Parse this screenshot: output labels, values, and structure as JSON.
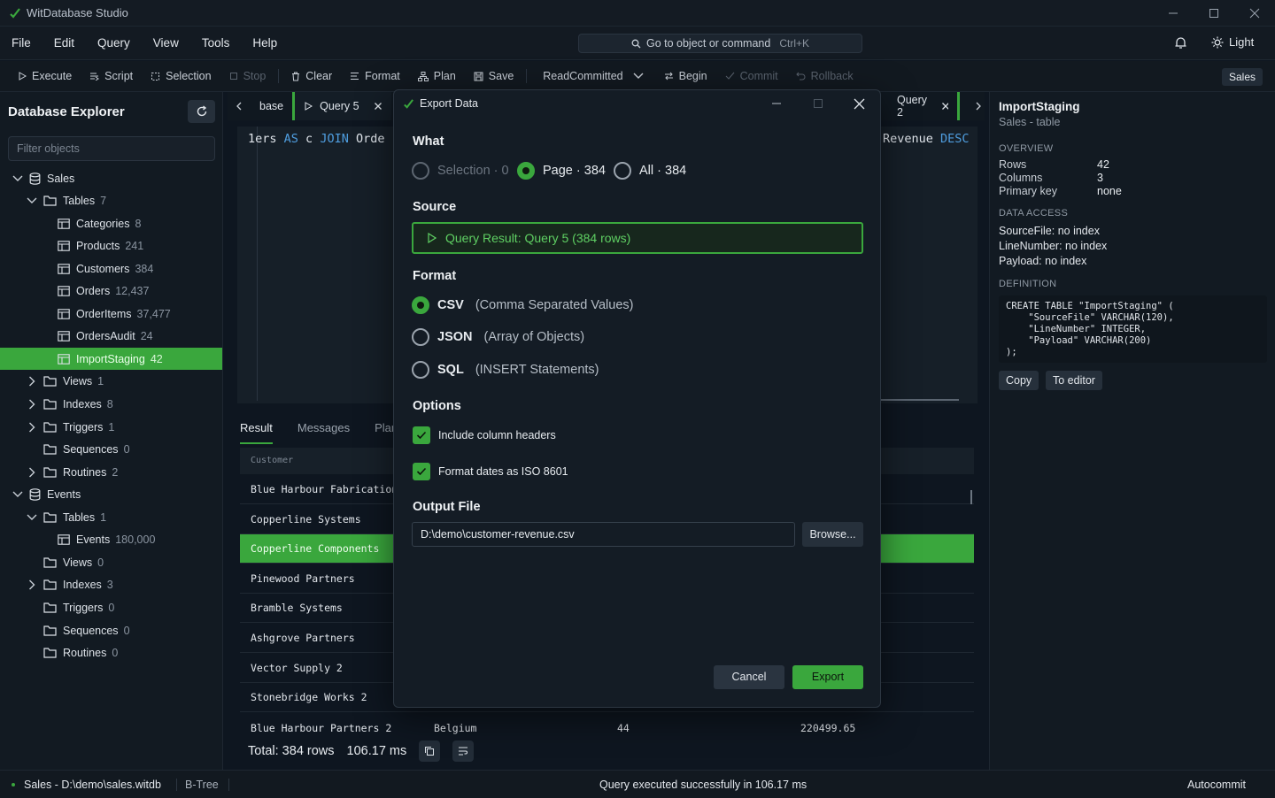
{
  "app": {
    "title": "WitDatabase Studio"
  },
  "menu": [
    "File",
    "Edit",
    "Query",
    "View",
    "Tools",
    "Help"
  ],
  "command": {
    "placeholder": "Go to object or command",
    "shortcut": "Ctrl+K"
  },
  "theme_label": "Light",
  "toolbar": {
    "execute": "Execute",
    "script": "Script",
    "selection": "Selection",
    "stop": "Stop",
    "clear": "Clear",
    "format": "Format",
    "plan": "Plan",
    "save": "Save",
    "isolation": "ReadCommitted",
    "begin": "Begin",
    "commit": "Commit",
    "rollback": "Rollback",
    "db": "Sales"
  },
  "explorer": {
    "title": "Database Explorer",
    "filter_placeholder": "Filter objects",
    "tree": [
      {
        "label": "Sales",
        "count": "",
        "level": 0,
        "kind": "db",
        "chev": "down"
      },
      {
        "label": "Tables",
        "count": "7",
        "level": 1,
        "kind": "folder",
        "chev": "down"
      },
      {
        "label": "Categories",
        "count": "8",
        "level": 2,
        "kind": "table",
        "chev": ""
      },
      {
        "label": "Products",
        "count": "241",
        "level": 2,
        "kind": "table",
        "chev": ""
      },
      {
        "label": "Customers",
        "count": "384",
        "level": 2,
        "kind": "table",
        "chev": ""
      },
      {
        "label": "Orders",
        "count": "12,437",
        "level": 2,
        "kind": "table",
        "chev": ""
      },
      {
        "label": "OrderItems",
        "count": "37,477",
        "level": 2,
        "kind": "table",
        "chev": ""
      },
      {
        "label": "OrdersAudit",
        "count": "24",
        "level": 2,
        "kind": "table",
        "chev": ""
      },
      {
        "label": "ImportStaging",
        "count": "42",
        "level": 2,
        "kind": "table",
        "chev": "",
        "selected": true
      },
      {
        "label": "Views",
        "count": "1",
        "level": 1,
        "kind": "folder",
        "chev": "right"
      },
      {
        "label": "Indexes",
        "count": "8",
        "level": 1,
        "kind": "folder",
        "chev": "right"
      },
      {
        "label": "Triggers",
        "count": "1",
        "level": 1,
        "kind": "folder",
        "chev": "right"
      },
      {
        "label": "Sequences",
        "count": "0",
        "level": 1,
        "kind": "folder",
        "chev": ""
      },
      {
        "label": "Routines",
        "count": "2",
        "level": 1,
        "kind": "folder",
        "chev": "right"
      },
      {
        "label": "Events",
        "count": "",
        "level": 0,
        "kind": "db",
        "chev": "down"
      },
      {
        "label": "Tables",
        "count": "1",
        "level": 1,
        "kind": "folder",
        "chev": "down"
      },
      {
        "label": "Events",
        "count": "180,000",
        "level": 2,
        "kind": "table",
        "chev": ""
      },
      {
        "label": "Views",
        "count": "0",
        "level": 1,
        "kind": "folder",
        "chev": ""
      },
      {
        "label": "Indexes",
        "count": "3",
        "level": 1,
        "kind": "folder",
        "chev": "right"
      },
      {
        "label": "Triggers",
        "count": "0",
        "level": 1,
        "kind": "folder",
        "chev": ""
      },
      {
        "label": "Sequences",
        "count": "0",
        "level": 1,
        "kind": "folder",
        "chev": ""
      },
      {
        "label": "Routines",
        "count": "0",
        "level": 1,
        "kind": "folder",
        "chev": ""
      }
    ]
  },
  "tabs": {
    "left_partial": "base",
    "query5": "Query 5",
    "query2": "Query 2"
  },
  "editor": {
    "line_no": "1",
    "left": {
      "a": "ers ",
      "k1": "AS",
      "b": " c ",
      "k2": "JOIN",
      "c": " Orde"
    },
    "right": {
      "a": "Revenue ",
      "k": "DESC"
    }
  },
  "result": {
    "tabs": [
      "Result",
      "Messages",
      "Plan"
    ],
    "column_header": "Customer",
    "rows": [
      "Blue Harbour Fabrication",
      "Copperline Systems",
      "Copperline Components",
      "Pinewood Partners",
      "Bramble Systems",
      "Ashgrove Partners",
      "Vector Supply 2",
      "Stonebridge Works 2"
    ],
    "last_row": {
      "customer": "Blue Harbour Partners 2",
      "country": "Belgium",
      "orders": "44",
      "revenue": "220499.65"
    },
    "selected_row": 2,
    "total": "Total: 384 rows",
    "time": "106.17 ms"
  },
  "panel": {
    "name": "ImportStaging",
    "subtitle": "Sales - table",
    "overview_label": "OVERVIEW",
    "overview": [
      {
        "k": "Rows",
        "v": "42"
      },
      {
        "k": "Columns",
        "v": "3"
      },
      {
        "k": "Primary key",
        "v": "none"
      }
    ],
    "access_label": "DATA ACCESS",
    "access": [
      "SourceFile: no index",
      "LineNumber: no index",
      "Payload: no index"
    ],
    "definition_label": "DEFINITION",
    "definition": "CREATE TABLE \"ImportStaging\" (\n    \"SourceFile\" VARCHAR(120),\n    \"LineNumber\" INTEGER,\n    \"Payload\" VARCHAR(200)\n);",
    "copy": "Copy",
    "to_editor": "To editor"
  },
  "status": {
    "connection": "Sales - D:\\demo\\sales.witdb",
    "engine": "B-Tree",
    "message": "Query executed successfully in 106.17 ms",
    "mode": "Autocommit"
  },
  "dialog": {
    "title": "Export Data",
    "what_label": "What",
    "what": [
      {
        "label": "Selection · 0",
        "state": "disabled"
      },
      {
        "label": "Page · 384",
        "state": "checked"
      },
      {
        "label": "All · 384",
        "state": "unchecked"
      }
    ],
    "source_label": "Source",
    "source_value": "Query Result: Query 5 (384 rows)",
    "format_label": "Format",
    "formats": [
      {
        "name": "CSV",
        "desc": "(Comma Separated Values)",
        "checked": true
      },
      {
        "name": "JSON",
        "desc": "(Array of Objects)",
        "checked": false
      },
      {
        "name": "SQL",
        "desc": "(INSERT Statements)",
        "checked": false
      }
    ],
    "options_label": "Options",
    "options": [
      "Include column headers",
      "Format dates as ISO 8601"
    ],
    "output_label": "Output File",
    "output_path": "D:\\demo\\customer-revenue.csv",
    "browse": "Browse...",
    "cancel": "Cancel",
    "export": "Export"
  },
  "colors": {
    "accent": "#3aa73d",
    "bg": "#0e1620",
    "panel": "#121a22"
  }
}
